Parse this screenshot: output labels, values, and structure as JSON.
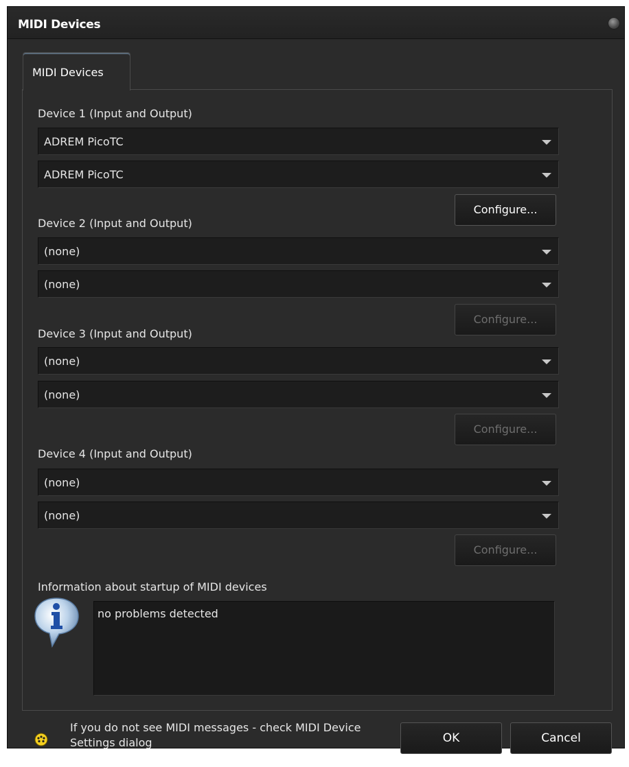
{
  "window": {
    "title": "MIDI Devices"
  },
  "tabs": [
    {
      "label": "MIDI Devices",
      "active": true
    }
  ],
  "devices": [
    {
      "label": "Device 1 (Input and Output)",
      "input": "ADREM PicoTC",
      "output": "ADREM PicoTC",
      "configure_label": "Configure...",
      "configure_enabled": true
    },
    {
      "label": "Device 2 (Input and Output)",
      "input": "(none)",
      "output": "(none)",
      "configure_label": "Configure...",
      "configure_enabled": false
    },
    {
      "label": "Device 3 (Input and Output)",
      "input": "(none)",
      "output": "(none)",
      "configure_label": "Configure...",
      "configure_enabled": false
    },
    {
      "label": "Device 4 (Input and Output)",
      "input": "(none)",
      "output": "(none)",
      "configure_label": "Configure...",
      "configure_enabled": false
    }
  ],
  "info": {
    "label": "Information about startup of MIDI devices",
    "text": "no problems detected",
    "icon": "info-icon"
  },
  "footer": {
    "hint": "If you do not see MIDI messages - check MIDI Device Settings dialog",
    "status_icon": "midi-plug-icon",
    "ok_label": "OK",
    "cancel_label": "Cancel"
  },
  "colors": {
    "window_bg": "#2b2b2b",
    "field_bg": "#1d1d1d",
    "text": "#e6e6e6",
    "disabled_text": "#6e6e6e"
  }
}
